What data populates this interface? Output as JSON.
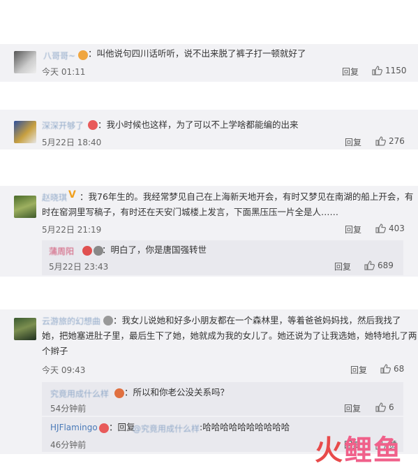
{
  "comments": [
    {
      "name": "八哥哥~",
      "text": "：叫他说句四川话听听，说不出来脱了裤子打一顿就好了",
      "time": "今天 01:11",
      "reply": "回复",
      "likes": "1150"
    },
    {
      "name": "深深开够了",
      "text": "：我小时候也这样，为了可以不上学啥都能编的出来",
      "time": "5月22日 18:40",
      "reply": "回复",
      "likes": "276"
    },
    {
      "name": "赵晓琪",
      "text1": "：我76年生的。我经常梦见自己在上海新天地开会，有时又梦见在南湖的船上开会，有",
      "text2": "时在窑洞里写稿子，有时还在天安门城楼上发言，下面黑压压一片全是人……",
      "time": "5月22日 21:19",
      "reply": "回复",
      "likes": "403",
      "sub": {
        "name": "蒲周阳",
        "text": "：明白了，你是唐国强转世",
        "time": "5月22日 23:43",
        "reply": "回复",
        "likes": "689"
      }
    },
    {
      "name": "云游旅的幻想曲",
      "text1": "：我女儿说她和好多小朋友都在一个森林里，等着爸爸妈妈找，然后我找了",
      "text2": "她，把她塞进肚子里，最后生下了她，她就成为我的女儿了。她还说为了让我选她，她特地扎了两",
      "text3": "个辫子",
      "time": "今天 09:43",
      "reply": "回复",
      "likes": "68",
      "subs": [
        {
          "name": "究竟用成什么样",
          "text": "：所以和你老公没关系吗？",
          "time": "54分钟前",
          "reply": "回复",
          "likes": "6"
        },
        {
          "name": "HJFlamingo",
          "prefix": "：回复",
          "mention": "@究竟用成什么样",
          "text": ":哈哈哈哈哈哈哈哈哈哈",
          "time": "46分钟前",
          "reply": "回复",
          "likes": "赞"
        }
      ]
    }
  ],
  "watermark": {
    "huo": "火",
    "li": "鲤",
    "yu": "鱼"
  },
  "colors": {
    "card": "#f2f2f5",
    "sub": "#e9e9ee",
    "name": "#8fa8c8",
    "watermark_red": "#e84a4a",
    "watermark_pink": "#f0608a"
  }
}
